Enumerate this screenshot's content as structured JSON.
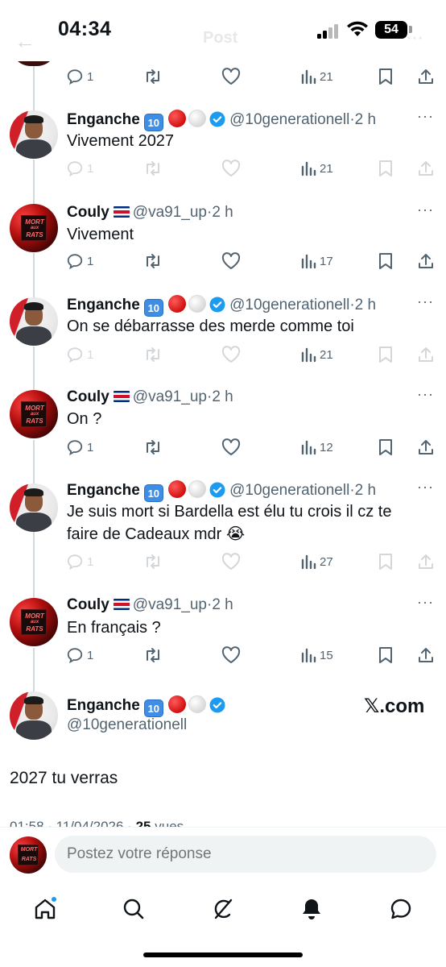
{
  "status_bar": {
    "time": "04:34",
    "battery": "54"
  },
  "header_ghost": {
    "title": "Post"
  },
  "users": {
    "enganche": {
      "name": "Enganche",
      "badge": "10",
      "handle": "@10generationell"
    },
    "couly": {
      "name": "Couly",
      "handle": "@va91_up"
    }
  },
  "dot": "·",
  "more": "···",
  "tweets": [
    {
      "time": "2 h",
      "text": "Vivement 2027",
      "replies": "1",
      "views": "21"
    },
    {
      "time": "2 h",
      "text": "Vivement",
      "replies": "1",
      "views": "17"
    },
    {
      "time": "2 h",
      "text": "On se débarrasse des merde comme toi",
      "replies": "1",
      "views": "21"
    },
    {
      "time": "2 h",
      "text": "On ?",
      "replies": "1",
      "views": "12"
    },
    {
      "time": "2 h",
      "text": "Je suis mort si Bardella est élu tu crois il cz te faire de Cadeaux mdr 😭",
      "replies": "1",
      "views": "27"
    },
    {
      "time": "2 h",
      "text": "En français ?",
      "replies": "1",
      "views": "15"
    }
  ],
  "top_partial": {
    "replies": "1",
    "views": "21"
  },
  "main_tweet": {
    "text": "2027 tu verras",
    "watermark": "𝕏.com",
    "timestamp": "01:58 · 11/04/2026 ·",
    "views_count": "25",
    "views_label": "vues"
  },
  "reply": {
    "placeholder": "Postez votre réponse"
  },
  "colors": {
    "accent": "#1d9bf0",
    "text": "#0f1419",
    "secondary": "#536471",
    "thread": "#cfd9de"
  },
  "nav": [
    "home-icon",
    "search-icon",
    "grok-icon",
    "notifications-icon",
    "messages-icon"
  ]
}
